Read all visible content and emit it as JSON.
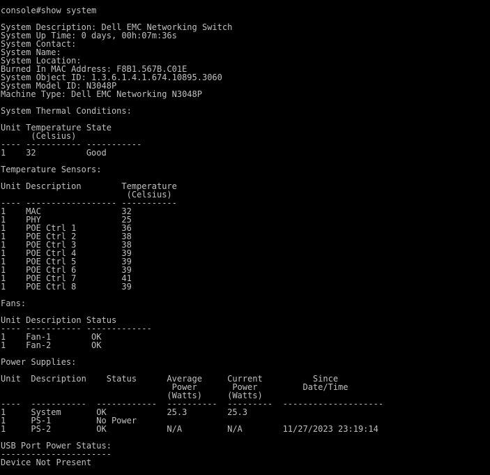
{
  "terminal": {
    "colors": {
      "background": "#000000",
      "foreground": "#c0c0c0"
    },
    "lines": [
      "console#show system",
      "",
      "System Description: Dell EMC Networking Switch",
      "System Up Time: 0 days, 00h:07m:36s",
      "System Contact:",
      "System Name:",
      "System Location:",
      "Burned In MAC Address: F8B1.567B.C01E",
      "System Object ID: 1.3.6.1.4.1.674.10895.3060",
      "System Model ID: N3048P",
      "Machine Type: Dell EMC Networking N3048P",
      "",
      "System Thermal Conditions:",
      "",
      "Unit Temperature State",
      "      (Celsius)",
      "---- ----------- -----------",
      "1    32          Good",
      "",
      "Temperature Sensors:",
      "",
      "Unit Description        Temperature",
      "                         (Celsius)",
      "---- ------------------ -----------",
      "1    MAC                32",
      "1    PHY                25",
      "1    POE Ctrl 1         36",
      "1    POE Ctrl 2         38",
      "1    POE Ctrl 3         38",
      "1    POE Ctrl 4         39",
      "1    POE Ctrl 5         39",
      "1    POE Ctrl 6         39",
      "1    POE Ctrl 7         41",
      "1    POE Ctrl 8         39",
      "",
      "Fans:",
      "",
      "Unit Description Status",
      "---- ----------- -------------",
      "1    Fan-1        OK",
      "1    Fan-2        OK",
      "",
      "Power Supplies:",
      "",
      "Unit  Description    Status      Average     Current          Since",
      "                                  Power       Power         Date/Time",
      "                                 (Watts)     (Watts)",
      "----  -----------  ------------  ----------  ---------  --------------------",
      "1     System       OK            25.3        25.3",
      "1     PS-1         No Power",
      "1     PS-2         OK            N/A         N/A        11/27/2023 23:19:14",
      "",
      "USB Port Power Status:",
      "----------------------",
      "Device Not Present"
    ]
  }
}
